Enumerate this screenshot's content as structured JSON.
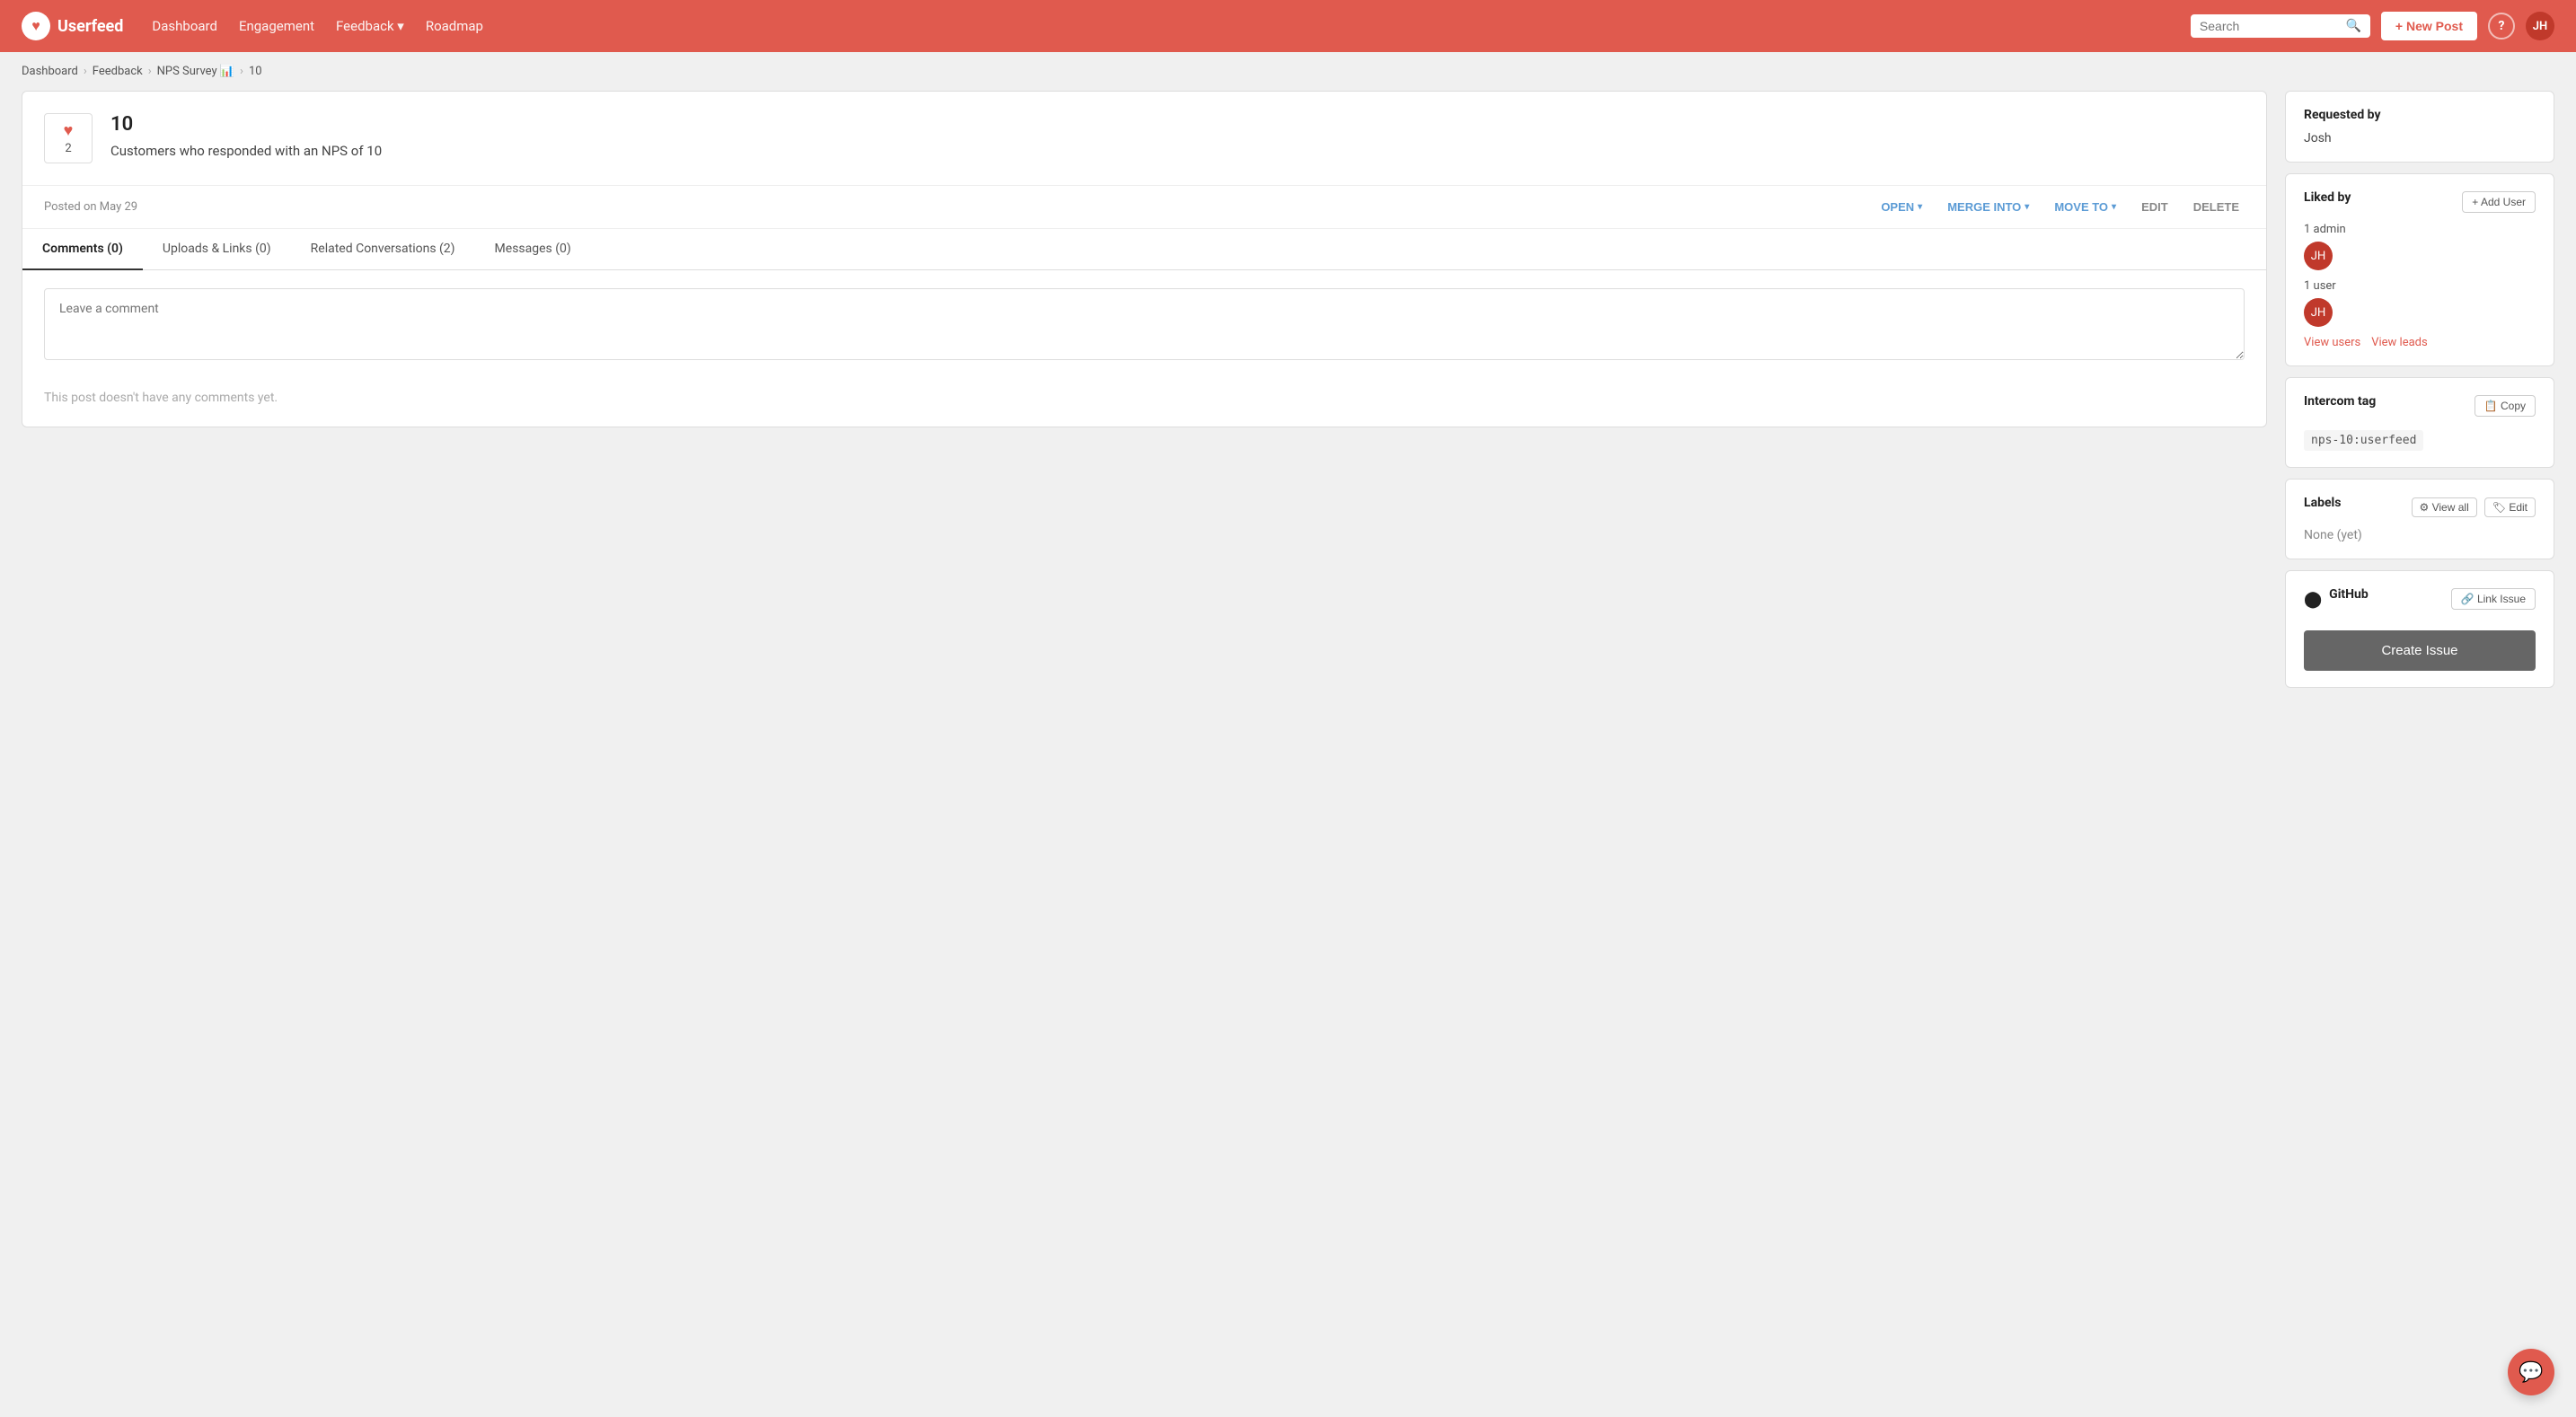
{
  "brand": {
    "name": "Userfeed",
    "heart": "♥"
  },
  "navbar": {
    "links": [
      {
        "label": "Dashboard",
        "id": "dashboard"
      },
      {
        "label": "Engagement",
        "id": "engagement"
      },
      {
        "label": "Feedback",
        "id": "feedback",
        "hasDropdown": true
      },
      {
        "label": "Roadmap",
        "id": "roadmap"
      }
    ],
    "search_placeholder": "Search",
    "new_post_label": "+ New Post",
    "help_label": "?",
    "user_initials": "JH"
  },
  "breadcrumb": {
    "items": [
      {
        "label": "Dashboard",
        "href": "#"
      },
      {
        "label": "Feedback",
        "href": "#"
      },
      {
        "label": "NPS Survey 📊",
        "href": "#"
      },
      {
        "label": "10",
        "href": "#"
      }
    ]
  },
  "post": {
    "vote_count": "2",
    "vote_heart": "♥",
    "title": "10",
    "description": "Customers who responded with an NPS of 10",
    "date": "Posted on May 29",
    "actions": {
      "open_label": "OPEN",
      "merge_into_label": "MERGE INTO",
      "move_to_label": "MOVE TO",
      "edit_label": "EDIT",
      "delete_label": "DELETE"
    }
  },
  "tabs": [
    {
      "label": "Comments (0)",
      "id": "comments",
      "active": true
    },
    {
      "label": "Uploads & Links (0)",
      "id": "uploads"
    },
    {
      "label": "Related Conversations (2)",
      "id": "conversations"
    },
    {
      "label": "Messages (0)",
      "id": "messages"
    }
  ],
  "comment": {
    "placeholder": "Leave a comment",
    "empty_message": "This post doesn't have any comments yet."
  },
  "sidebar": {
    "requested_by": {
      "title": "Requested by",
      "name": "Josh"
    },
    "liked_by": {
      "title": "Liked by",
      "add_user_label": "+ Add User",
      "admin_count": "1 admin",
      "user_count": "1 user",
      "view_users_label": "View users",
      "view_leads_label": "View leads"
    },
    "intercom_tag": {
      "title": "Intercom tag",
      "copy_label": "📋 Copy",
      "value": "nps-10:userfeed"
    },
    "labels": {
      "title": "Labels",
      "view_all_label": "⚙ View all",
      "edit_label": "🏷 Edit",
      "none_label": "None (yet)"
    },
    "github": {
      "title": "GitHub",
      "link_issue_label": "🔗 Link Issue",
      "create_issue_label": "Create Issue"
    }
  }
}
